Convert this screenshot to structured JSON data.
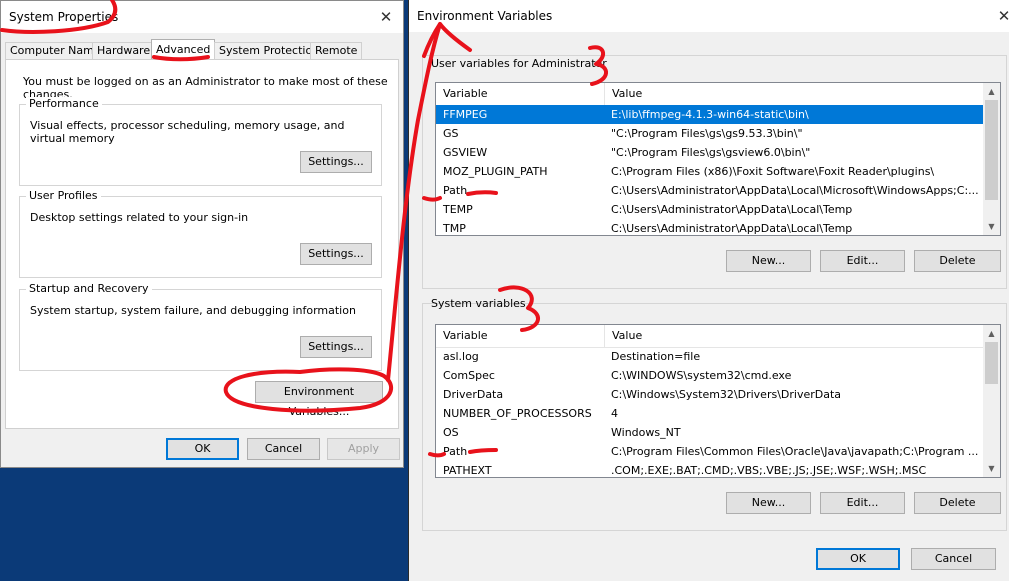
{
  "system_properties": {
    "title": "System Properties",
    "close_glyph": "✕",
    "tabs": [
      "Computer Name",
      "Hardware",
      "Advanced",
      "System Protection",
      "Remote"
    ],
    "active_tab": "Advanced",
    "admin_note": "You must be logged on as an Administrator to make most of these changes.",
    "performance": {
      "label": "Performance",
      "description": "Visual effects, processor scheduling, memory usage, and virtual memory",
      "button": "Settings..."
    },
    "user_profiles": {
      "label": "User Profiles",
      "description": "Desktop settings related to your sign-in",
      "button": "Settings..."
    },
    "startup_recovery": {
      "label": "Startup and Recovery",
      "description": "System startup, system failure, and debugging information",
      "button": "Settings..."
    },
    "env_button": "Environment Variables...",
    "ok": "OK",
    "cancel": "Cancel",
    "apply": "Apply"
  },
  "environment_variables": {
    "title": "Environment Variables",
    "close_glyph": "✕",
    "user_section_label": "User variables for Administrator",
    "columns": [
      "Variable",
      "Value"
    ],
    "user_vars": [
      {
        "name": "FFMPEG",
        "value": "E:\\lib\\ffmpeg-4.1.3-win64-static\\bin\\",
        "selected": true
      },
      {
        "name": "GS",
        "value": "\"C:\\Program Files\\gs\\gs9.53.3\\bin\\\""
      },
      {
        "name": "GSVIEW",
        "value": "\"C:\\Program Files\\gs\\gsview6.0\\bin\\\""
      },
      {
        "name": "MOZ_PLUGIN_PATH",
        "value": "C:\\Program Files (x86)\\Foxit Software\\Foxit Reader\\plugins\\"
      },
      {
        "name": "Path",
        "value": "C:\\Users\\Administrator\\AppData\\Local\\Microsoft\\WindowsApps;C:..."
      },
      {
        "name": "TEMP",
        "value": "C:\\Users\\Administrator\\AppData\\Local\\Temp"
      },
      {
        "name": "TMP",
        "value": "C:\\Users\\Administrator\\AppData\\Local\\Temp"
      }
    ],
    "user_buttons": {
      "new": "New...",
      "edit": "Edit...",
      "delete": "Delete"
    },
    "system_section_label": "System variables",
    "system_vars": [
      {
        "name": "asl.log",
        "value": "Destination=file"
      },
      {
        "name": "ComSpec",
        "value": "C:\\WINDOWS\\system32\\cmd.exe"
      },
      {
        "name": "DriverData",
        "value": "C:\\Windows\\System32\\Drivers\\DriverData"
      },
      {
        "name": "NUMBER_OF_PROCESSORS",
        "value": "4"
      },
      {
        "name": "OS",
        "value": "Windows_NT"
      },
      {
        "name": "Path",
        "value": "C:\\Program Files\\Common Files\\Oracle\\Java\\javapath;C:\\Program ..."
      },
      {
        "name": "PATHEXT",
        "value": ".COM;.EXE;.BAT;.CMD;.VBS;.VBE;.JS;.JSE;.WSF;.WSH;.MSC"
      }
    ],
    "system_buttons": {
      "new": "New...",
      "edit": "Edit...",
      "delete": "Delete"
    },
    "ok": "OK",
    "cancel": "Cancel"
  },
  "colors": {
    "annotation": "#e8121b",
    "selection": "#0078d7",
    "desktop": "#0b3a78"
  },
  "icons": {
    "scroll_up": "▲",
    "scroll_down": "▼"
  }
}
